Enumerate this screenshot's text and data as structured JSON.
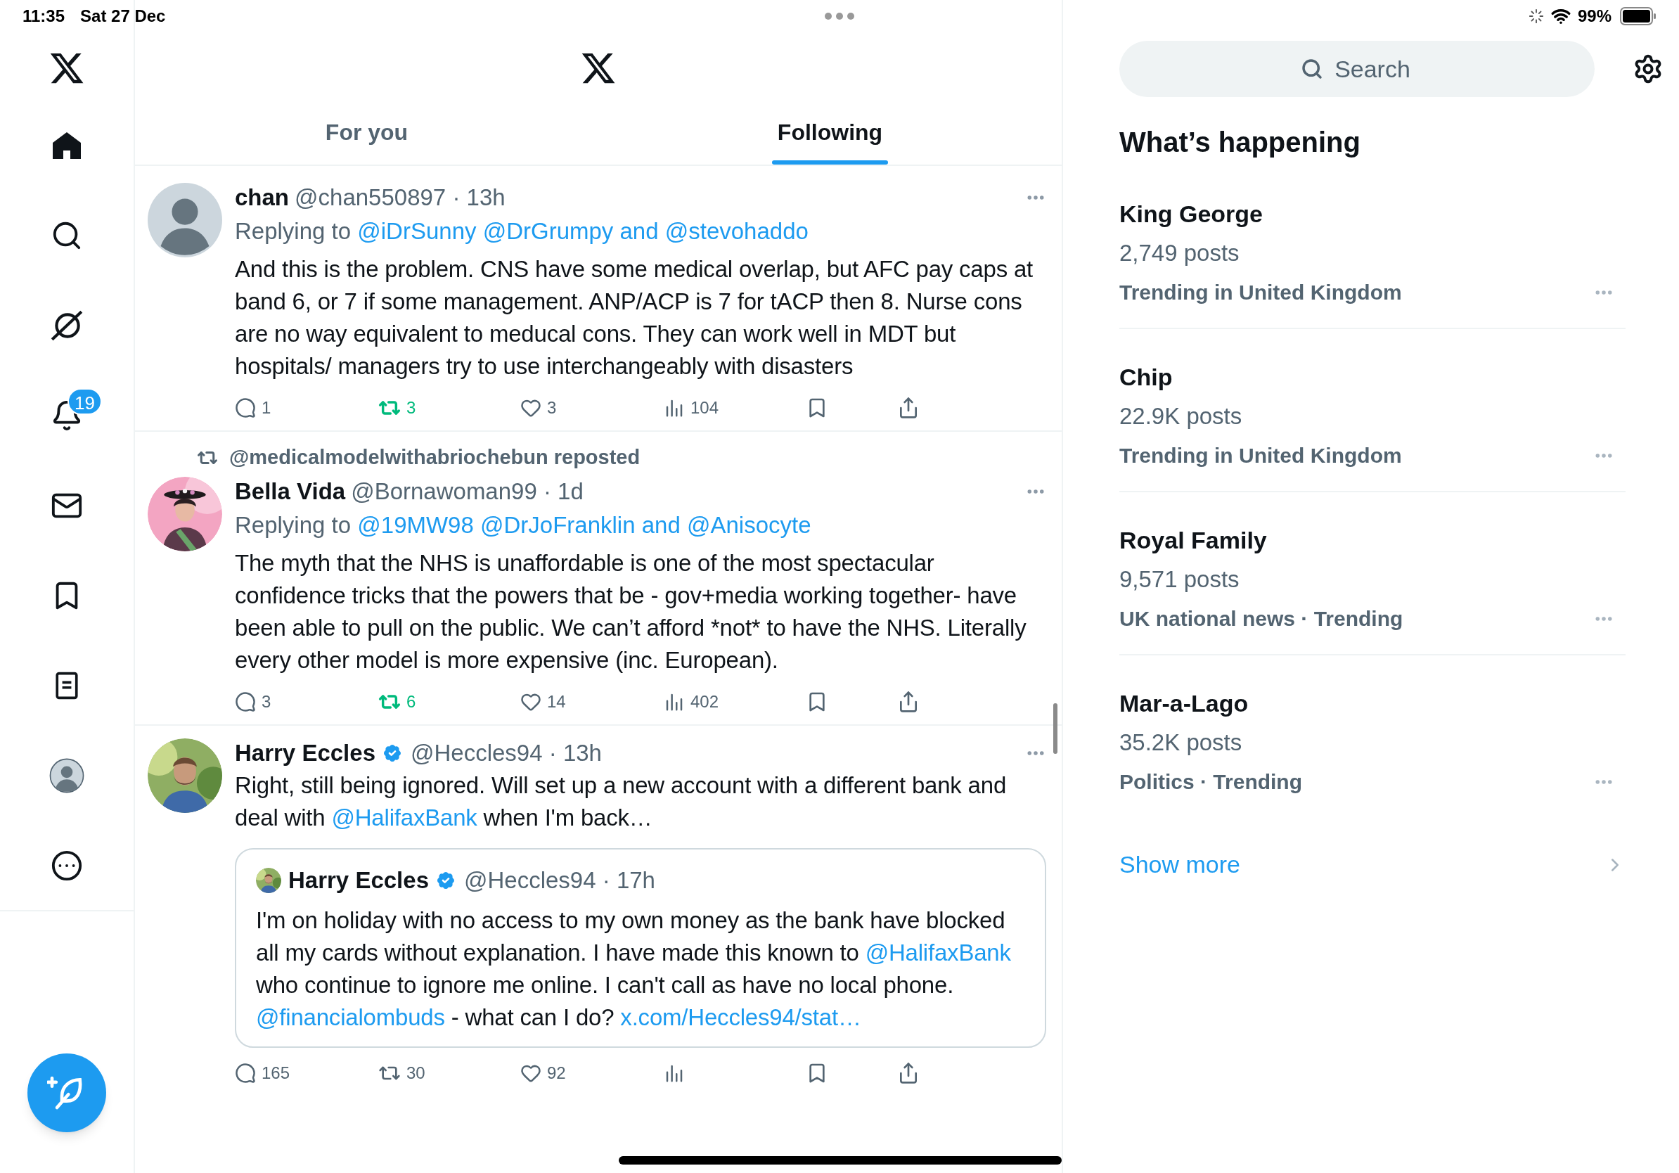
{
  "status_bar": {
    "time": "11:35",
    "date": "Sat 27 Dec",
    "battery": "99%"
  },
  "rail": {
    "items": [
      {
        "kind": "home",
        "selected": true
      },
      {
        "kind": "search",
        "selected": false
      },
      {
        "kind": "grok",
        "selected": false
      },
      {
        "kind": "notifications",
        "selected": false,
        "badge": "19"
      },
      {
        "kind": "messages",
        "selected": false
      },
      {
        "kind": "bookmarks",
        "selected": false
      },
      {
        "kind": "lists",
        "selected": false
      },
      {
        "kind": "profile",
        "selected": false
      },
      {
        "kind": "more",
        "selected": false
      }
    ]
  },
  "tabs": [
    {
      "label": "For you",
      "selected": false
    },
    {
      "label": "Following",
      "selected": true
    }
  ],
  "tweets": [
    {
      "avatar": {
        "kind": "default"
      },
      "name": "chan",
      "verified": false,
      "handle_line": "@chan550897 · 13h",
      "replying_label": "Replying to",
      "replying_to": "@iDrSunny @DrGrumpy and @stevohaddo",
      "body": [
        {
          "text": "And this is the problem. CNS have some medical overlap, but AFC pay caps at band 6, or 7 if some management. ANP/ACP is 7 for tACP then 8. Nurse cons are no way equivalent to meducal cons. They can work well in MDT but hospitals/ managers try to use interchangeably with disasters"
        }
      ],
      "stats": {
        "replies": "1",
        "reposts": "3",
        "reposted": true,
        "likes": "3",
        "views": "104"
      }
    },
    {
      "repost_line": "@medicalmodelwithabriochebun reposted",
      "avatar": {
        "kind": "picture"
      },
      "name": "Bella Vida",
      "verified": false,
      "handle_line": "@Bornawoman99 · 1d",
      "replying_label": "Replying to",
      "replying_to": "@19MW98 @DrJoFranklin and @Anisocyte",
      "body": [
        {
          "text": "The myth that the NHS is unaffordable is one of the most spectacular confidence tricks that the powers that be - gov+media working together- have been able to pull on the public. We can’t afford *not* to have the NHS. Literally every other model is more expensive (inc. European)."
        }
      ],
      "stats": {
        "replies": "3",
        "reposts": "6",
        "reposted": true,
        "likes": "14",
        "views": "402"
      }
    },
    {
      "avatar": {
        "kind": "picture"
      },
      "name": "Harry Eccles",
      "verified": true,
      "handle_line": "@Heccles94 · 13h",
      "body": [
        {
          "text": "Right, still being ignored. Will set up a new account with a different bank and deal with "
        },
        {
          "text": "@HalifaxBank",
          "link": true
        },
        {
          "text": " when I'm back…"
        }
      ],
      "quote": {
        "name": "Harry Eccles",
        "verified": true,
        "handle_line": "@Heccles94 · 17h",
        "body": [
          {
            "text": "I'm on holiday with no access to my own money as the bank have blocked all my cards without explanation. I have made this known to "
          },
          {
            "text": "@HalifaxBank",
            "link": true
          },
          {
            "text": " who continue to ignore me online. I can't call as have no local phone. "
          },
          {
            "text": "@financialombuds",
            "link": true
          },
          {
            "text": " - what can I do? "
          },
          {
            "text": "x.com/Heccles94/stat…",
            "link": true
          }
        ]
      },
      "stats": {
        "replies": "165",
        "reposts": "30",
        "reposted": false,
        "likes": "92"
      }
    }
  ],
  "search": {
    "placeholder": "Search"
  },
  "trends_title": "What’s happening",
  "trends": [
    {
      "name": "King George",
      "posts": "2,749 posts",
      "context": "Trending in United Kingdom"
    },
    {
      "name": "Chip",
      "posts": "22.9K posts",
      "context": "Trending in United Kingdom"
    },
    {
      "name": "Royal Family",
      "posts": "9,571 posts",
      "context": "UK national news · Trending"
    },
    {
      "name": "Mar-a-Lago",
      "posts": "35.2K posts",
      "context": "Politics · Trending"
    }
  ],
  "show_more": "Show more"
}
